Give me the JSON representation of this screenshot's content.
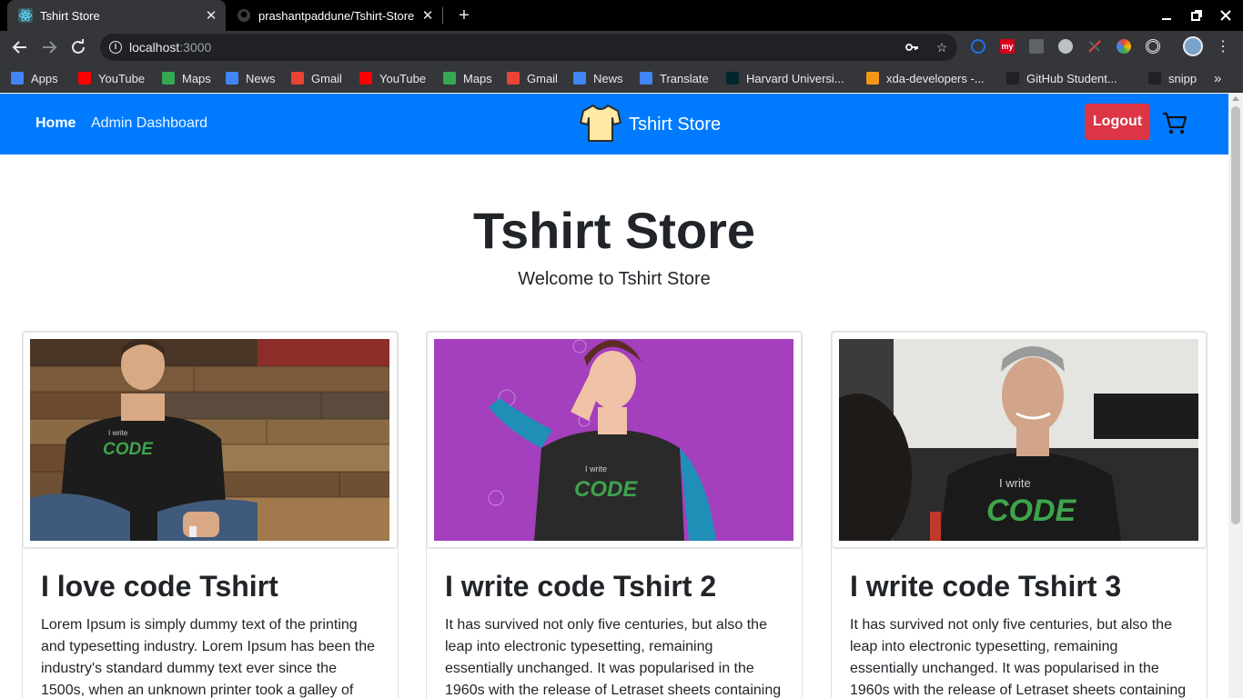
{
  "browser": {
    "tabs": [
      {
        "title": "Tshirt Store",
        "active": true
      },
      {
        "title": "prashantpaddune/Tshirt-Store",
        "active": false
      }
    ],
    "url_host": "localhost",
    "url_port": ":3000",
    "bookmarks": [
      {
        "label": "Apps",
        "icon": "apps-grid-icon",
        "color": "#4285f4"
      },
      {
        "label": "YouTube",
        "icon": "youtube-icon",
        "color": "#ff0000"
      },
      {
        "label": "Maps",
        "icon": "maps-icon",
        "color": "#34a853"
      },
      {
        "label": "News",
        "icon": "news-icon",
        "color": "#4285f4"
      },
      {
        "label": "Gmail",
        "icon": "gmail-icon",
        "color": "#ea4335"
      },
      {
        "label": "YouTube",
        "icon": "youtube-icon",
        "color": "#ff0000"
      },
      {
        "label": "Maps",
        "icon": "maps-icon",
        "color": "#34a853"
      },
      {
        "label": "Gmail",
        "icon": "gmail-icon",
        "color": "#ea4335"
      },
      {
        "label": "News",
        "icon": "news-icon",
        "color": "#4285f4"
      },
      {
        "label": "Translate",
        "icon": "translate-icon",
        "color": "#4285f4"
      },
      {
        "label": "Harvard Universi...",
        "icon": "edx-icon",
        "color": "#02262b"
      },
      {
        "label": "xda-developers -...",
        "icon": "xda-icon",
        "color": "#f59714"
      },
      {
        "label": "GitHub Student...",
        "icon": "github-icon",
        "color": "#202124"
      },
      {
        "label": "snipp",
        "icon": "github-icon",
        "color": "#202124"
      }
    ],
    "more_bookmarks": "»"
  },
  "navbar": {
    "home": "Home",
    "admin": "Admin Dashboard",
    "brand": "Tshirt Store",
    "logout": "Logout"
  },
  "hero": {
    "title": "Tshirt Store",
    "subtitle": "Welcome to Tshirt Store"
  },
  "products": [
    {
      "title": "I love code Tshirt",
      "text": "Lorem Ipsum is simply dummy text of the printing and typesetting industry. Lorem Ipsum has been the industry's standard dummy text ever since the 1500s, when an unknown printer took a galley of",
      "shirt_print_top": "I write",
      "shirt_print_main": "CODE"
    },
    {
      "title": "I write code Tshirt 2",
      "text": "It has survived not only five centuries, but also the leap into electronic typesetting, remaining essentially unchanged. It was popularised in the 1960s with the release of Letraset sheets containing",
      "shirt_print_top": "I write",
      "shirt_print_main": "CODE"
    },
    {
      "title": "I write code Tshirt 3",
      "text": "It has survived not only five centuries, but also the leap into electronic typesetting, remaining essentially unchanged. It was popularised in the 1960s with the release of Letraset sheets containing",
      "shirt_print_top": "I write",
      "shirt_print_main": "CODE"
    }
  ]
}
